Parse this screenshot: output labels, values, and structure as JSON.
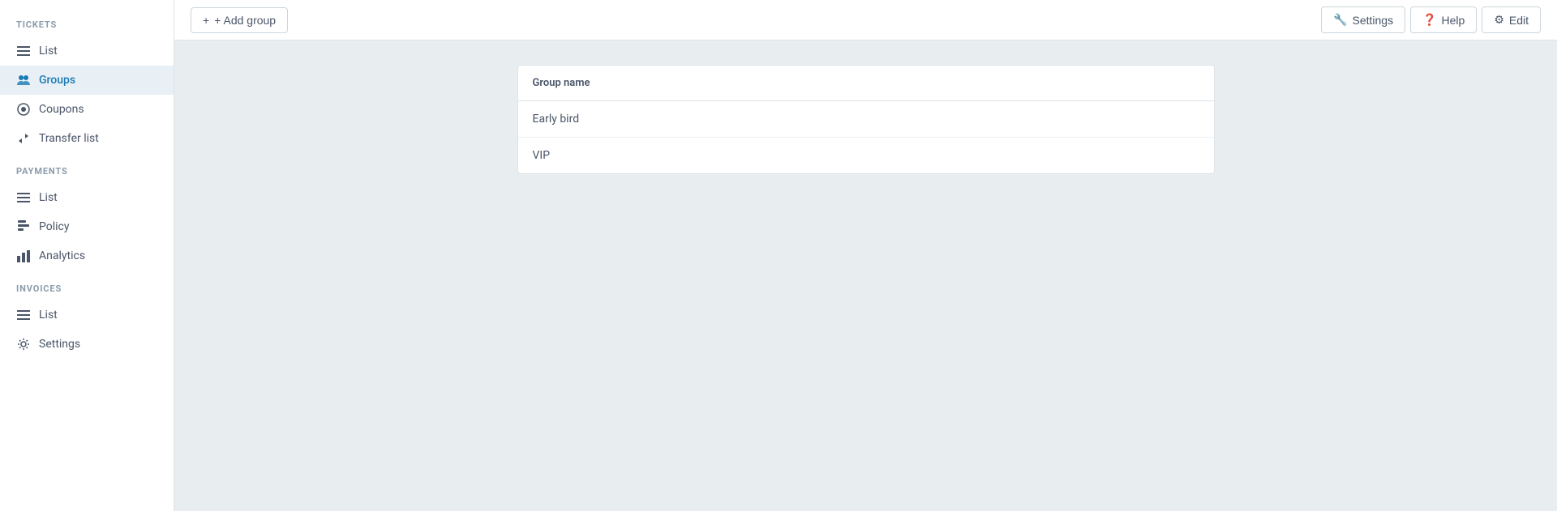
{
  "sidebar": {
    "sections": [
      {
        "label": "TICKETS",
        "items": [
          {
            "id": "tickets-list",
            "label": "List",
            "icon": "list-icon",
            "active": false
          },
          {
            "id": "tickets-groups",
            "label": "Groups",
            "icon": "groups-icon",
            "active": true
          },
          {
            "id": "tickets-coupons",
            "label": "Coupons",
            "icon": "coupons-icon",
            "active": false
          },
          {
            "id": "tickets-transfer-list",
            "label": "Transfer list",
            "icon": "transfer-icon",
            "active": false
          }
        ]
      },
      {
        "label": "PAYMENTS",
        "items": [
          {
            "id": "payments-list",
            "label": "List",
            "icon": "list-icon",
            "active": false
          },
          {
            "id": "payments-policy",
            "label": "Policy",
            "icon": "policy-icon",
            "active": false
          },
          {
            "id": "payments-analytics",
            "label": "Analytics",
            "icon": "analytics-icon",
            "active": false
          }
        ]
      },
      {
        "label": "INVOICES",
        "items": [
          {
            "id": "invoices-list",
            "label": "List",
            "icon": "list-icon",
            "active": false
          },
          {
            "id": "invoices-settings",
            "label": "Settings",
            "icon": "settings-icon",
            "active": false
          }
        ]
      }
    ]
  },
  "topbar": {
    "add_group_label": "+ Add group",
    "settings_label": "Settings",
    "help_label": "Help",
    "edit_label": "Edit"
  },
  "table": {
    "header": "Group name",
    "rows": [
      {
        "name": "Early bird"
      },
      {
        "name": "VIP"
      }
    ]
  }
}
